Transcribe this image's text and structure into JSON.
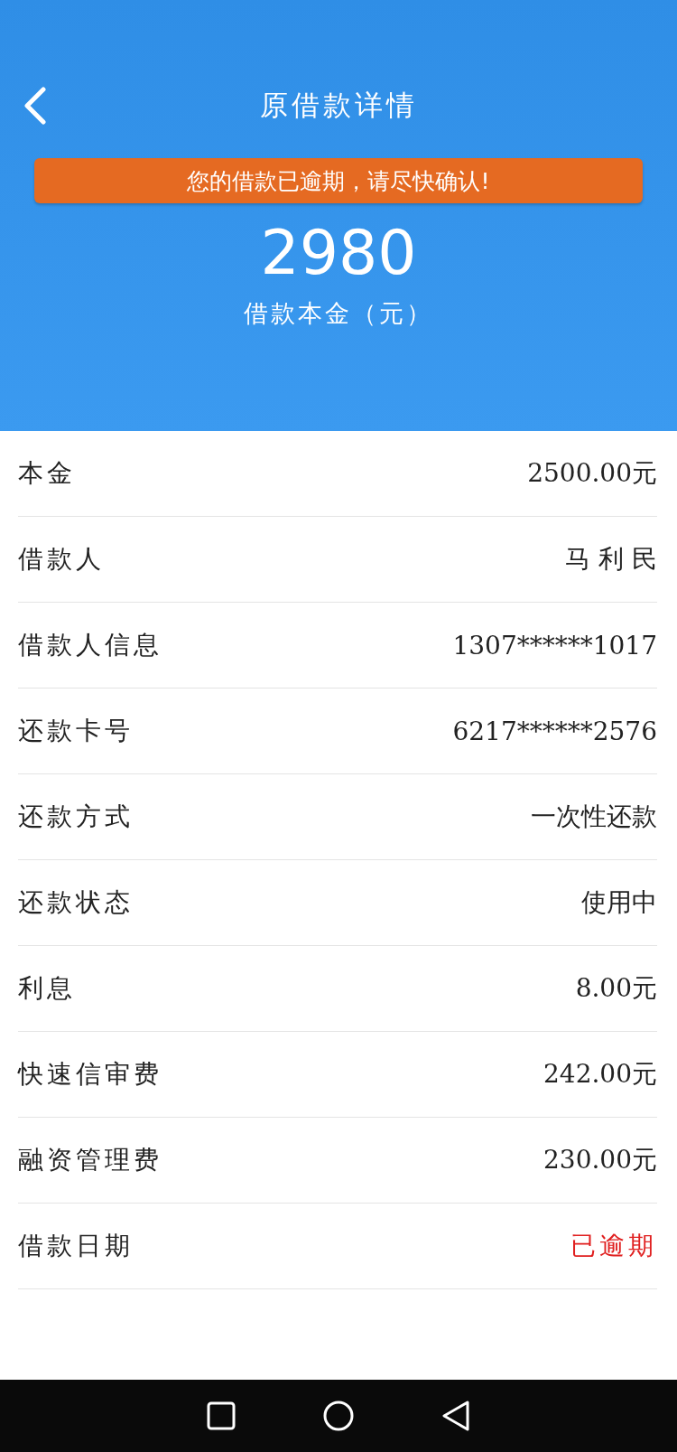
{
  "header": {
    "title": "原借款详情",
    "notice": "您的借款已逾期，请尽快确认!",
    "amount": "2980",
    "amount_label": "借款本金（元）"
  },
  "rows": [
    {
      "label": "本金",
      "value": "2500.00元",
      "alert": false
    },
    {
      "label": "借款人",
      "value": "马 利 民",
      "alert": false
    },
    {
      "label": "借款人信息",
      "value": "1307******1017",
      "alert": false
    },
    {
      "label": "还款卡号",
      "value": "6217******2576",
      "alert": false
    },
    {
      "label": "还款方式",
      "value": "一次性还款",
      "alert": false
    },
    {
      "label": "还款状态",
      "value": "使用中",
      "alert": false
    },
    {
      "label": "利息",
      "value": "8.00元",
      "alert": false
    },
    {
      "label": "快速信审费",
      "value": "242.00元",
      "alert": false
    },
    {
      "label": "融资管理费",
      "value": "230.00元",
      "alert": false
    },
    {
      "label": "借款日期",
      "value": "已逾期",
      "alert": true
    }
  ]
}
